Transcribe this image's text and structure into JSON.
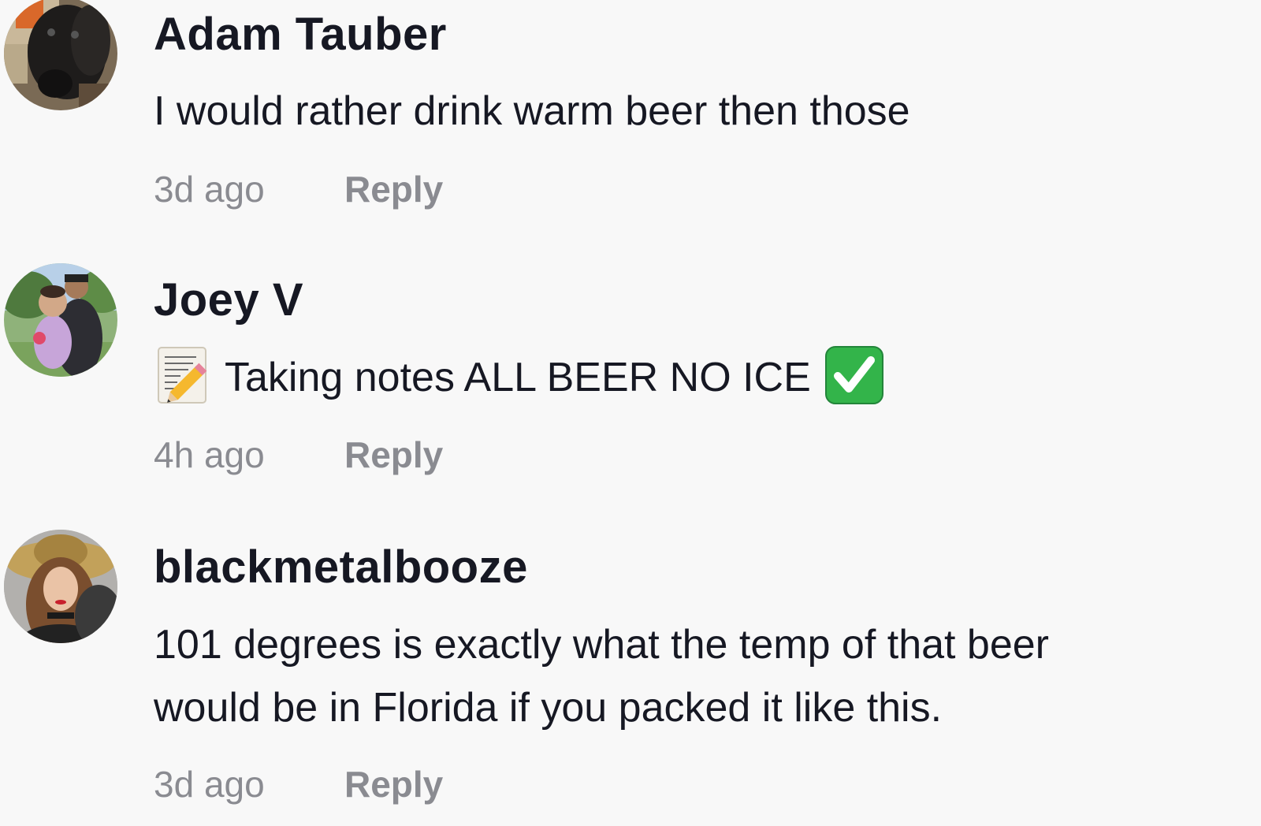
{
  "comments": [
    {
      "username": "Adam Tauber",
      "avatar_icon": "dog-avatar-icon",
      "text_lines": [
        "I would rather drink warm beer then those"
      ],
      "time": "3d ago",
      "reply_label": "Reply"
    },
    {
      "username": "Joey V",
      "avatar_icon": "family-avatar-icon",
      "emoji_before": "memo-icon",
      "text_lines": [
        "Taking notes ALL BEER NO ICE"
      ],
      "emoji_after": "check-mark-button-icon",
      "time": "4h ago",
      "reply_label": "Reply"
    },
    {
      "username": "blackmetalbooze",
      "avatar_icon": "woman-hat-avatar-icon",
      "text_lines": [
        "101 degrees is exactly what the temp of that beer",
        "would be in Florida if you packed it like this."
      ],
      "time": "3d ago",
      "reply_label": "Reply"
    }
  ],
  "colors": {
    "background": "#f8f8f8",
    "text": "#161823",
    "meta": "#8a8b91",
    "check_green": "#33b44a"
  }
}
